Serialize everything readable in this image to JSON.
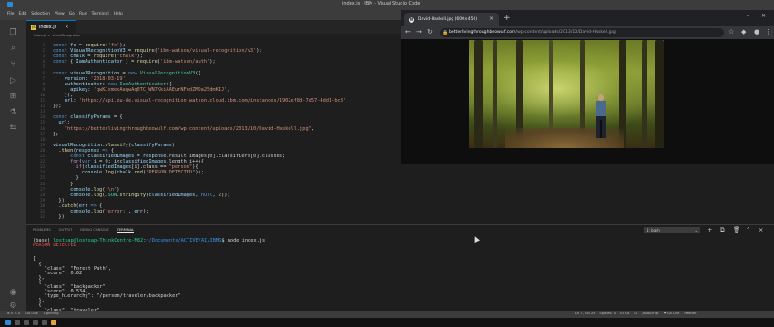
{
  "vscode": {
    "window_title": "index.js - IBM - Visual Studio Code",
    "menu": [
      "File",
      "Edit",
      "Selection",
      "View",
      "Go",
      "Run",
      "Terminal",
      "Help"
    ],
    "tab": {
      "label": "index.js",
      "badge": "JS",
      "close": "×"
    },
    "breadcrumb": [
      "index.js",
      ">",
      "visualRecognition"
    ],
    "code": [
      {
        "n": "1",
        "parts": [
          [
            "kw",
            "const "
          ],
          [
            "var",
            "fs"
          ],
          [
            "pun",
            " = "
          ],
          [
            "fn",
            "require"
          ],
          [
            "pun",
            "("
          ],
          [
            "str",
            "'fs'"
          ],
          [
            "pun",
            ");"
          ]
        ]
      },
      {
        "n": "2",
        "parts": [
          [
            "kw",
            "const "
          ],
          [
            "var",
            "VisualRecognitionV3"
          ],
          [
            "pun",
            " = "
          ],
          [
            "fn",
            "require"
          ],
          [
            "pun",
            "("
          ],
          [
            "str",
            "'ibm-watson/visual-recognition/v3'"
          ],
          [
            "pun",
            ");"
          ]
        ]
      },
      {
        "n": "3",
        "parts": [
          [
            "kw",
            "const "
          ],
          [
            "var",
            "chalk"
          ],
          [
            "pun",
            " = "
          ],
          [
            "fn",
            "require"
          ],
          [
            "pun",
            "("
          ],
          [
            "str",
            "\"chalk\""
          ],
          [
            "pun",
            ");"
          ]
        ]
      },
      {
        "n": "4",
        "parts": [
          [
            "kw",
            "const "
          ],
          [
            "pun",
            "{ "
          ],
          [
            "var",
            "IamAuthenticator"
          ],
          [
            "pun",
            " } = "
          ],
          [
            "fn",
            "require"
          ],
          [
            "pun",
            "("
          ],
          [
            "str",
            "'ibm-watson/auth'"
          ],
          [
            "pun",
            ");"
          ]
        ]
      },
      {
        "n": "5",
        "parts": []
      },
      {
        "n": "6",
        "parts": [
          [
            "kw",
            "const "
          ],
          [
            "var",
            "visualRecognition"
          ],
          [
            "pun",
            " = "
          ],
          [
            "kw",
            "new "
          ],
          [
            "cls",
            "VisualRecognitionV3"
          ],
          [
            "pun",
            "({"
          ]
        ]
      },
      {
        "n": "7",
        "parts": [
          [
            "pun",
            "    "
          ],
          [
            "var",
            "version"
          ],
          [
            "pun",
            ": "
          ],
          [
            "str",
            "'2018-03-19'"
          ],
          [
            "pun",
            ","
          ]
        ]
      },
      {
        "n": "8",
        "parts": [
          [
            "pun",
            "    "
          ],
          [
            "var",
            "authenticator"
          ],
          [
            "pun",
            ": "
          ],
          [
            "kw",
            "new "
          ],
          [
            "cls",
            "IamAuthenticator"
          ],
          [
            "pun",
            "({"
          ]
        ]
      },
      {
        "n": "9",
        "parts": [
          [
            "pun",
            "      "
          ],
          [
            "var",
            "apikey"
          ],
          [
            "pun",
            ": "
          ],
          [
            "str",
            "'qwKJxmexAaqwAq0TC_WN7KkiAAEurNFedZMDa25dmKIJ'"
          ],
          [
            "pun",
            ","
          ]
        ]
      },
      {
        "n": "10",
        "parts": [
          [
            "pun",
            "    }),"
          ]
        ]
      },
      {
        "n": "11",
        "parts": [
          [
            "pun",
            "    "
          ],
          [
            "var",
            "url"
          ],
          [
            "pun",
            ": "
          ],
          [
            "str",
            "'https://api.eu-de.visual-recognition.watson.cloud.ibm.com/instances/1902ef8d-7d57-4dd1-bc8'"
          ]
        ]
      },
      {
        "n": "12",
        "parts": [
          [
            "pun",
            "});"
          ]
        ]
      },
      {
        "n": "13",
        "parts": []
      },
      {
        "n": "14",
        "parts": [
          [
            "kw",
            "const "
          ],
          [
            "var",
            "classifyParams"
          ],
          [
            "pun",
            " = {"
          ]
        ]
      },
      {
        "n": "15",
        "parts": [
          [
            "pun",
            "  "
          ],
          [
            "var",
            "url"
          ],
          [
            "pun",
            ":"
          ]
        ]
      },
      {
        "n": "16",
        "parts": [
          [
            "pun",
            "    "
          ],
          [
            "str",
            "\"https://betterlivingthroughbeowulf.com/wp-content/uploads/2013/10/David-Haskell.jpg\""
          ],
          [
            "pun",
            ","
          ]
        ]
      },
      {
        "n": "17",
        "parts": [
          [
            "pun",
            "};"
          ]
        ]
      },
      {
        "n": "18",
        "parts": []
      },
      {
        "n": "19",
        "parts": [
          [
            "var",
            "visualRecognition"
          ],
          [
            "pun",
            "."
          ],
          [
            "fn",
            "classify"
          ],
          [
            "pun",
            "("
          ],
          [
            "var",
            "classifyParams"
          ],
          [
            "pun",
            ")"
          ]
        ]
      },
      {
        "n": "20",
        "parts": [
          [
            "pun",
            "  ."
          ],
          [
            "fn",
            "then"
          ],
          [
            "pun",
            "("
          ],
          [
            "var",
            "response"
          ],
          [
            "kw",
            " => "
          ],
          [
            "pun",
            "{"
          ]
        ]
      },
      {
        "n": "21",
        "parts": [
          [
            "pun",
            "      "
          ],
          [
            "kw",
            "const "
          ],
          [
            "var",
            "classifiedImages"
          ],
          [
            "pun",
            " = "
          ],
          [
            "var",
            "response"
          ],
          [
            "pun",
            ".result.images["
          ],
          [
            "num",
            "0"
          ],
          [
            "pun",
            "].classifiers["
          ],
          [
            "num",
            "0"
          ],
          [
            "pun",
            "].classes;"
          ]
        ]
      },
      {
        "n": "22",
        "parts": [
          [
            "pun",
            "      "
          ],
          [
            "ctl",
            "for"
          ],
          [
            "pun",
            "("
          ],
          [
            "kw",
            "var "
          ],
          [
            "var",
            "i"
          ],
          [
            "pun",
            " = "
          ],
          [
            "num",
            "0"
          ],
          [
            "pun",
            "; i<"
          ],
          [
            "var",
            "classifiedImages"
          ],
          [
            "pun",
            ".length;i++){"
          ]
        ]
      },
      {
        "n": "23",
        "parts": [
          [
            "pun",
            "        "
          ],
          [
            "ctl",
            "if"
          ],
          [
            "pun",
            "("
          ],
          [
            "var",
            "classifiedImages"
          ],
          [
            "pun",
            "[i].class == "
          ],
          [
            "str",
            "\"person\""
          ],
          [
            "pun",
            "){"
          ]
        ]
      },
      {
        "n": "24",
        "parts": [
          [
            "pun",
            "          "
          ],
          [
            "var",
            "console"
          ],
          [
            "pun",
            "."
          ],
          [
            "fn",
            "log"
          ],
          [
            "pun",
            "("
          ],
          [
            "var",
            "chalk"
          ],
          [
            "pun",
            "."
          ],
          [
            "fn",
            "red"
          ],
          [
            "pun",
            "("
          ],
          [
            "str",
            "\"PERSON DETECTED\""
          ],
          [
            "pun",
            "));"
          ]
        ]
      },
      {
        "n": "25",
        "parts": [
          [
            "pun",
            "        }"
          ]
        ]
      },
      {
        "n": "26",
        "parts": [
          [
            "pun",
            "      }"
          ]
        ]
      },
      {
        "n": "27",
        "parts": [
          [
            "pun",
            "      "
          ],
          [
            "var",
            "console"
          ],
          [
            "pun",
            "."
          ],
          [
            "fn",
            "log"
          ],
          [
            "pun",
            "("
          ],
          [
            "str",
            "'\\n'"
          ],
          [
            "pun",
            ")"
          ]
        ]
      },
      {
        "n": "28",
        "parts": [
          [
            "pun",
            "      "
          ],
          [
            "var",
            "console"
          ],
          [
            "pun",
            "."
          ],
          [
            "fn",
            "log"
          ],
          [
            "pun",
            "("
          ],
          [
            "cls",
            "JSON"
          ],
          [
            "pun",
            "."
          ],
          [
            "fn",
            "stringify"
          ],
          [
            "pun",
            "("
          ],
          [
            "var",
            "classifiedImages"
          ],
          [
            "pun",
            ", "
          ],
          [
            "kw",
            "null"
          ],
          [
            "pun",
            ", "
          ],
          [
            "num",
            "2"
          ],
          [
            "pun",
            "));"
          ]
        ]
      },
      {
        "n": "29",
        "parts": [
          [
            "pun",
            "  })"
          ]
        ]
      },
      {
        "n": "30",
        "parts": [
          [
            "pun",
            "  ."
          ],
          [
            "fn",
            "catch"
          ],
          [
            "pun",
            "("
          ],
          [
            "var",
            "err"
          ],
          [
            "kw",
            " => "
          ],
          [
            "pun",
            "{"
          ]
        ]
      },
      {
        "n": "31",
        "parts": [
          [
            "pun",
            "      "
          ],
          [
            "var",
            "console"
          ],
          [
            "pun",
            "."
          ],
          [
            "fn",
            "log"
          ],
          [
            "pun",
            "("
          ],
          [
            "str",
            "'error:'"
          ],
          [
            "pun",
            ", "
          ],
          [
            "var",
            "err"
          ],
          [
            "pun",
            ");"
          ]
        ]
      },
      {
        "n": "32",
        "parts": [
          [
            "pun",
            "  });"
          ]
        ]
      }
    ],
    "panel": {
      "tabs": [
        "PROBLEMS",
        "OUTPUT",
        "DEBUG CONSOLE",
        "TERMINAL"
      ],
      "active_tab": "TERMINAL",
      "shell": "1: bash",
      "tools": [
        "+",
        "⧉",
        "🗑",
        "^",
        "×"
      ]
    },
    "terminal": [
      {
        "parts": [
          [
            "pun",
            "(base) "
          ],
          [
            "green",
            "lostsap@lostsap-ThinkCentre-M82"
          ],
          [
            "pun",
            ":"
          ],
          [
            "blue",
            "~/Documents/ACTIVE/AI/IBMS"
          ],
          [
            "pun",
            "$ node index.js"
          ]
        ]
      },
      {
        "parts": [
          [
            "red",
            "PERSON DETECTED"
          ]
        ]
      },
      {
        "parts": []
      },
      {
        "parts": []
      },
      {
        "parts": [
          [
            "pun",
            "["
          ]
        ]
      },
      {
        "parts": [
          [
            "pun",
            "  {"
          ]
        ]
      },
      {
        "parts": [
          [
            "pun",
            "    \"class\": \"Forest Path\","
          ]
        ]
      },
      {
        "parts": [
          [
            "pun",
            "    \"score\": 0.62"
          ]
        ]
      },
      {
        "parts": [
          [
            "pun",
            "  },"
          ]
        ]
      },
      {
        "parts": [
          [
            "pun",
            "  {"
          ]
        ]
      },
      {
        "parts": [
          [
            "pun",
            "    \"class\": \"backpacker\","
          ]
        ]
      },
      {
        "parts": [
          [
            "pun",
            "    \"score\": 0.534,"
          ]
        ]
      },
      {
        "parts": [
          [
            "pun",
            "    \"type_hierarchy\": \"/person/traveler/backpacker\""
          ]
        ]
      },
      {
        "parts": [
          [
            "pun",
            "  },"
          ]
        ]
      },
      {
        "parts": [
          [
            "pun",
            "  {"
          ]
        ]
      },
      {
        "parts": [
          [
            "pun",
            "    \"class\": \"traveler\","
          ]
        ]
      }
    ],
    "status_left": [
      "⊗ 0 ⚠ 0",
      "Go Live",
      "Lightning"
    ],
    "status_right": [
      "Ln 7, Col 25",
      "Spaces: 4",
      "UTF-8",
      "LF",
      "JavaScript",
      "⚑ Go Live",
      "Prettier"
    ]
  },
  "chrome": {
    "tab_title": "David-Haskell.jpg (600×450)",
    "url_host": "betterlivingthroughbeowulf.com",
    "url_path": "/wp-content/uploads/2013/10/David-Haskell.jpg",
    "wp_icon": "W"
  }
}
